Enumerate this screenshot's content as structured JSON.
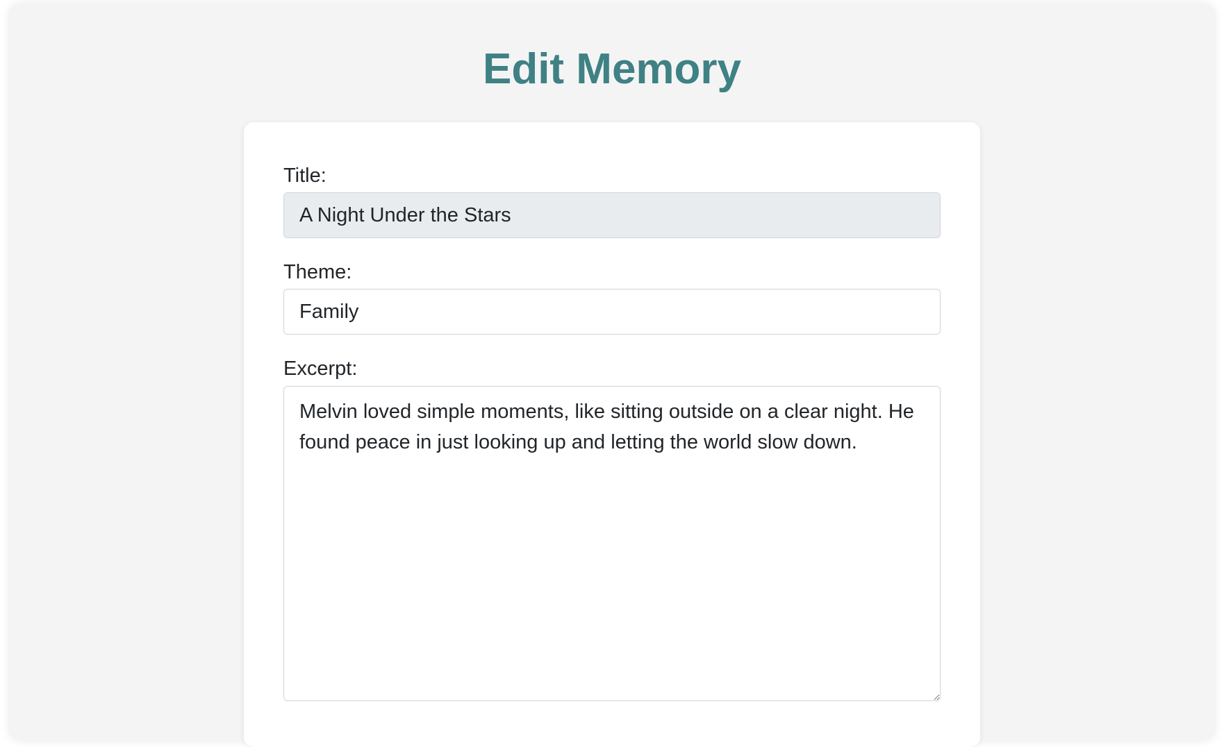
{
  "page": {
    "title": "Edit Memory"
  },
  "form": {
    "title_label": "Title:",
    "title_value": "A Night Under the Stars",
    "theme_label": "Theme:",
    "theme_value": "Family",
    "excerpt_label": "Excerpt:",
    "excerpt_value": "Melvin loved simple moments, like sitting outside on a clear night. He found peace in just looking up and letting the world slow down."
  },
  "colors": {
    "accent": "#3f8184",
    "background": "#f4f4f4",
    "readonly_input": "#e9ecef"
  }
}
